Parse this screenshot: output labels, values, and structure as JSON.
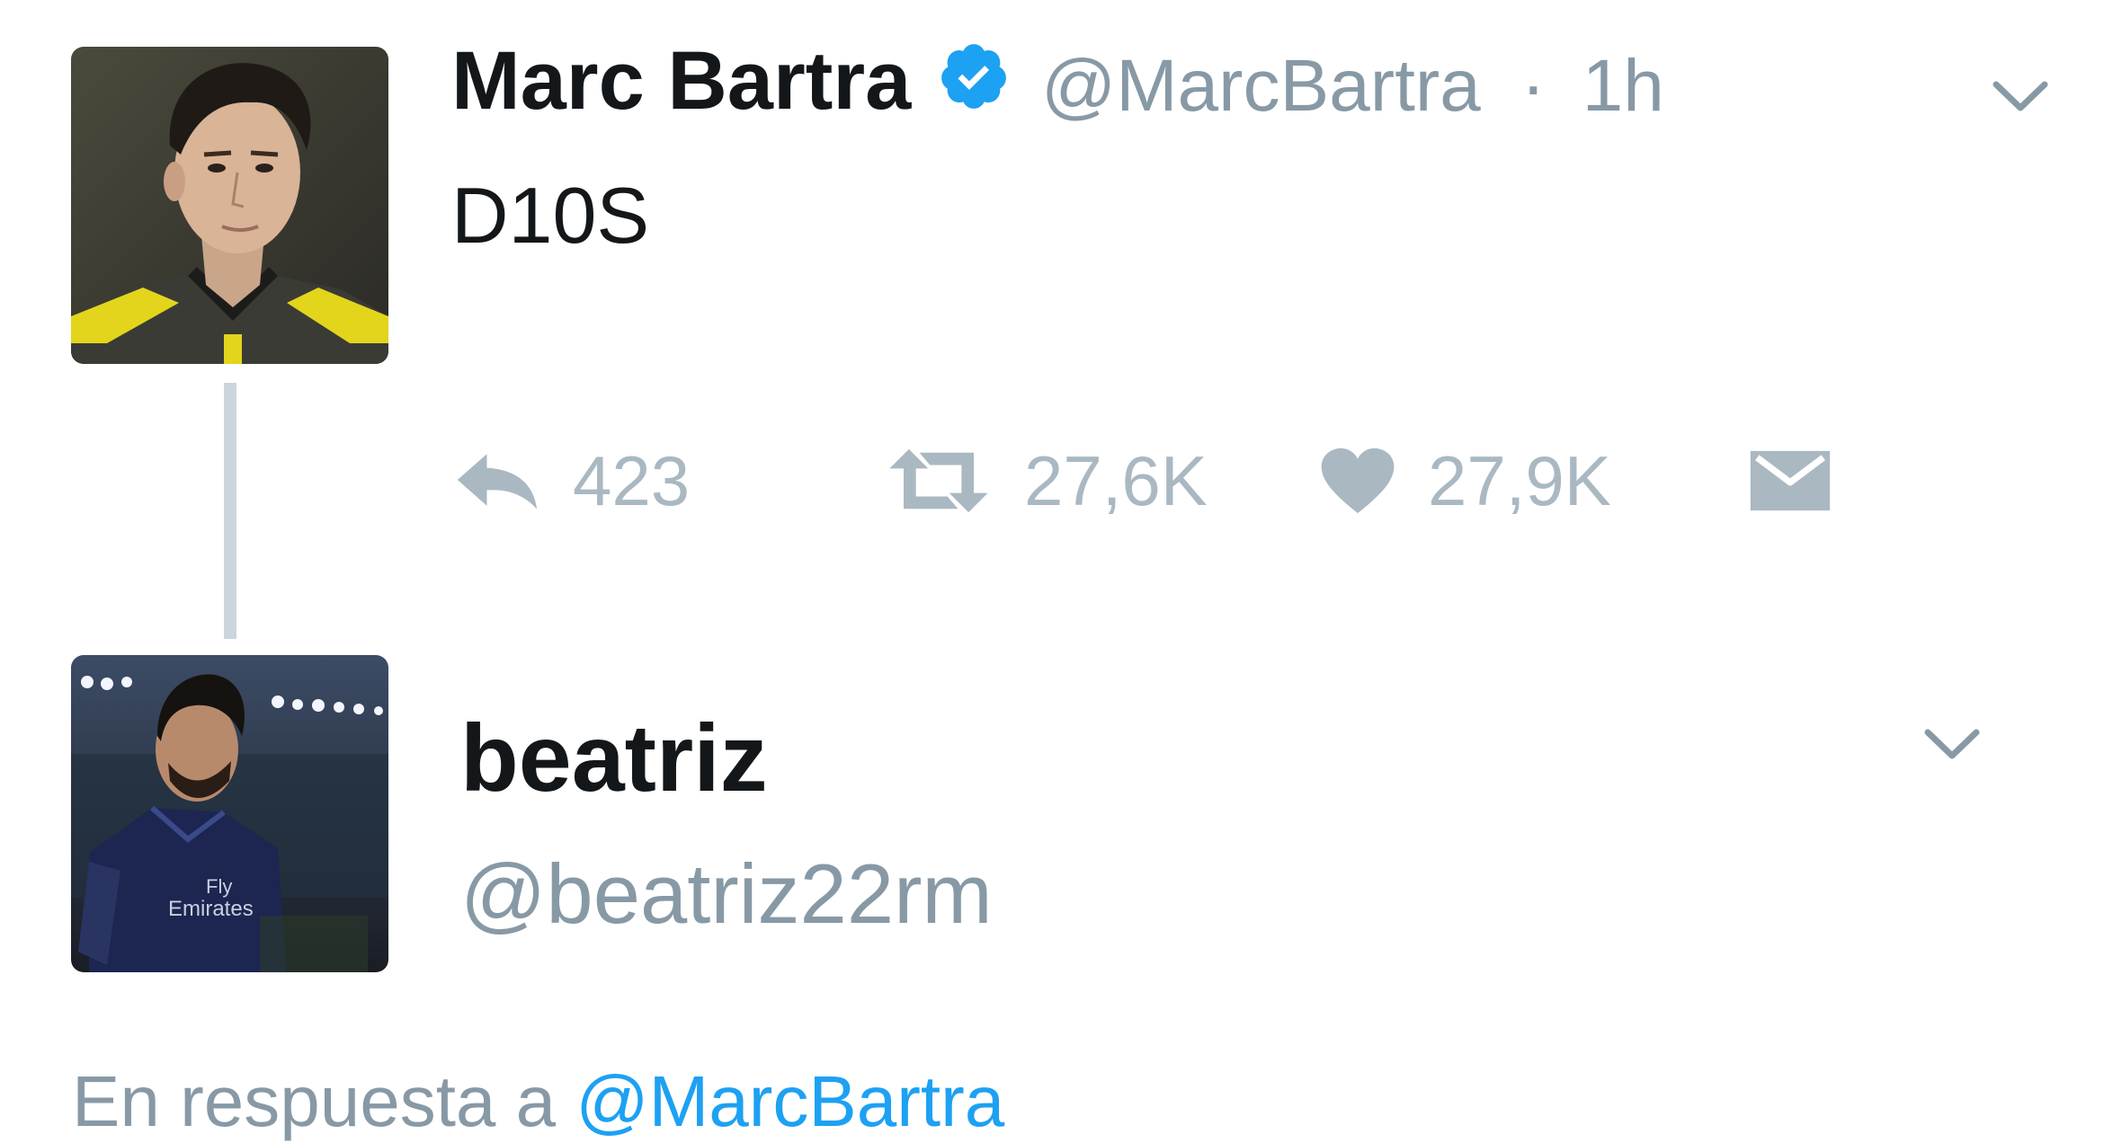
{
  "tweet": {
    "author_name": "Marc Bartra",
    "verified": true,
    "handle": "@MarcBartra",
    "separator": "·",
    "time": "1h",
    "text": "D10S",
    "actions": {
      "reply_count": "423",
      "retweet_count": "27,6K",
      "like_count": "27,9K"
    }
  },
  "reply": {
    "author_name": "beatriz",
    "handle": "@beatriz22rm",
    "reply_context_prefix": "En respuesta a",
    "reply_context_mention": "@MarcBartra"
  },
  "colors": {
    "verified_blue": "#1da1f2",
    "muted_gray": "#8899a6",
    "icon_gray": "#aab8c2",
    "text_dark": "#14171a",
    "link_blue": "#1da1f2"
  },
  "icons": {
    "verified": "verified-badge-icon",
    "chevron": "chevron-down-icon",
    "reply": "reply-icon",
    "retweet": "retweet-icon",
    "like": "heart-icon",
    "dm": "envelope-icon"
  }
}
